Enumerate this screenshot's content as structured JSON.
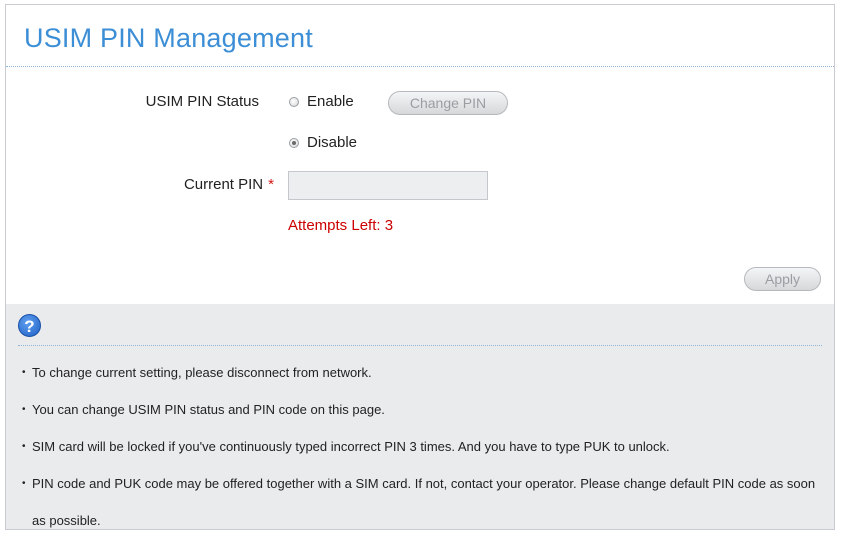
{
  "header": {
    "title": "USIM PIN Management"
  },
  "form": {
    "status_label": "USIM PIN Status",
    "enable_label": "Enable",
    "disable_label": "Disable",
    "selected_option": "Disable",
    "change_pin_label": "Change PIN",
    "current_pin_label": "Current PIN",
    "required_marker": "*",
    "current_pin_value": "",
    "attempts_text": "Attempts Left: 3",
    "apply_label": "Apply"
  },
  "help": {
    "icon": "question-mark-icon",
    "icon_glyph": "?",
    "items": [
      "To change current setting, please disconnect from network.",
      "You can change USIM PIN status and PIN code on this page.",
      "SIM card will be locked if you've continuously typed incorrect PIN 3 times. And you have to type PUK to unlock.",
      "PIN code and PUK code may be offered together with a SIM card. If not, contact your operator. Please change default PIN code as soon as possible."
    ]
  },
  "colors": {
    "title": "#3c8ed6",
    "attempts": "#cc0000",
    "help_background": "#e9ebed"
  }
}
